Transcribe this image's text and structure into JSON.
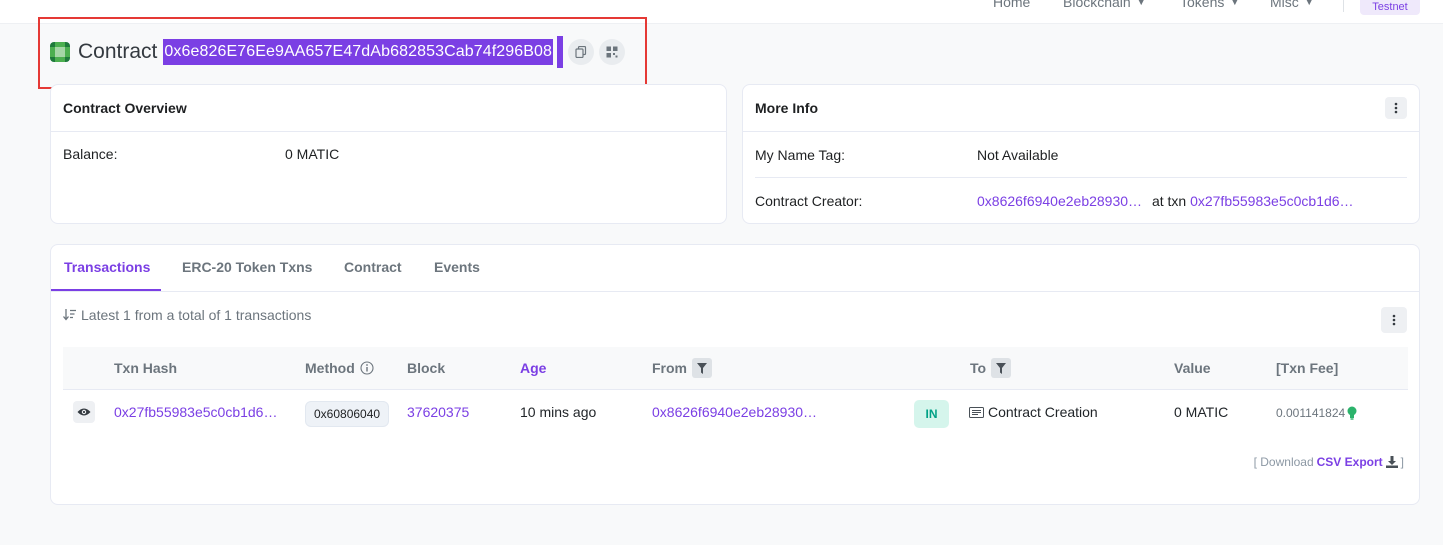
{
  "nav": {
    "items": [
      {
        "label": "Home",
        "dropdown": false
      },
      {
        "label": "Blockchain",
        "dropdown": true
      },
      {
        "label": "Tokens",
        "dropdown": true
      },
      {
        "label": "Misc",
        "dropdown": true
      }
    ],
    "network_badge": "Testnet"
  },
  "header": {
    "label": "Contract",
    "address": "0x6e826E76Ee9AA657E47dAb682853Cab74f296B08",
    "copy_icon": "copy-icon",
    "qr_icon": "qr-code-icon"
  },
  "overview": {
    "title": "Contract Overview",
    "balance_label": "Balance:",
    "balance_value": "0 MATIC"
  },
  "more_info": {
    "title": "More Info",
    "name_tag_label": "My Name Tag:",
    "name_tag_value": "Not Available",
    "creator_label": "Contract Creator:",
    "creator_address": "0x8626f6940e2eb28930…",
    "at_txn_label": "at txn",
    "creator_txn": "0x27fb55983e5c0cb1d6…"
  },
  "tabs": [
    {
      "label": "Transactions",
      "active": true
    },
    {
      "label": "ERC-20 Token Txns",
      "active": false
    },
    {
      "label": "Contract",
      "active": false
    },
    {
      "label": "Events",
      "active": false
    }
  ],
  "summary": "Latest 1 from a total of 1 transactions",
  "table": {
    "headers": {
      "txn_hash": "Txn Hash",
      "method": "Method",
      "block": "Block",
      "age": "Age",
      "from": "From",
      "to": "To",
      "value": "Value",
      "txn_fee": "[Txn Fee]"
    },
    "rows": [
      {
        "txn_hash": "0x27fb55983e5c0cb1d6…",
        "method": "0x60806040",
        "block": "37620375",
        "age": "10 mins ago",
        "from": "0x8626f6940e2eb28930…",
        "direction": "IN",
        "to": "Contract Creation",
        "value": "0 MATIC",
        "txn_fee": "0.001141824"
      }
    ]
  },
  "csv": {
    "prefix": "[ Download",
    "link": "CSV Export",
    "suffix": "]"
  },
  "colors": {
    "accent": "#7b3fe4",
    "highlight_border": "#e53935",
    "in_badge_bg": "#d5f5ec",
    "in_badge_text": "#00a186"
  }
}
